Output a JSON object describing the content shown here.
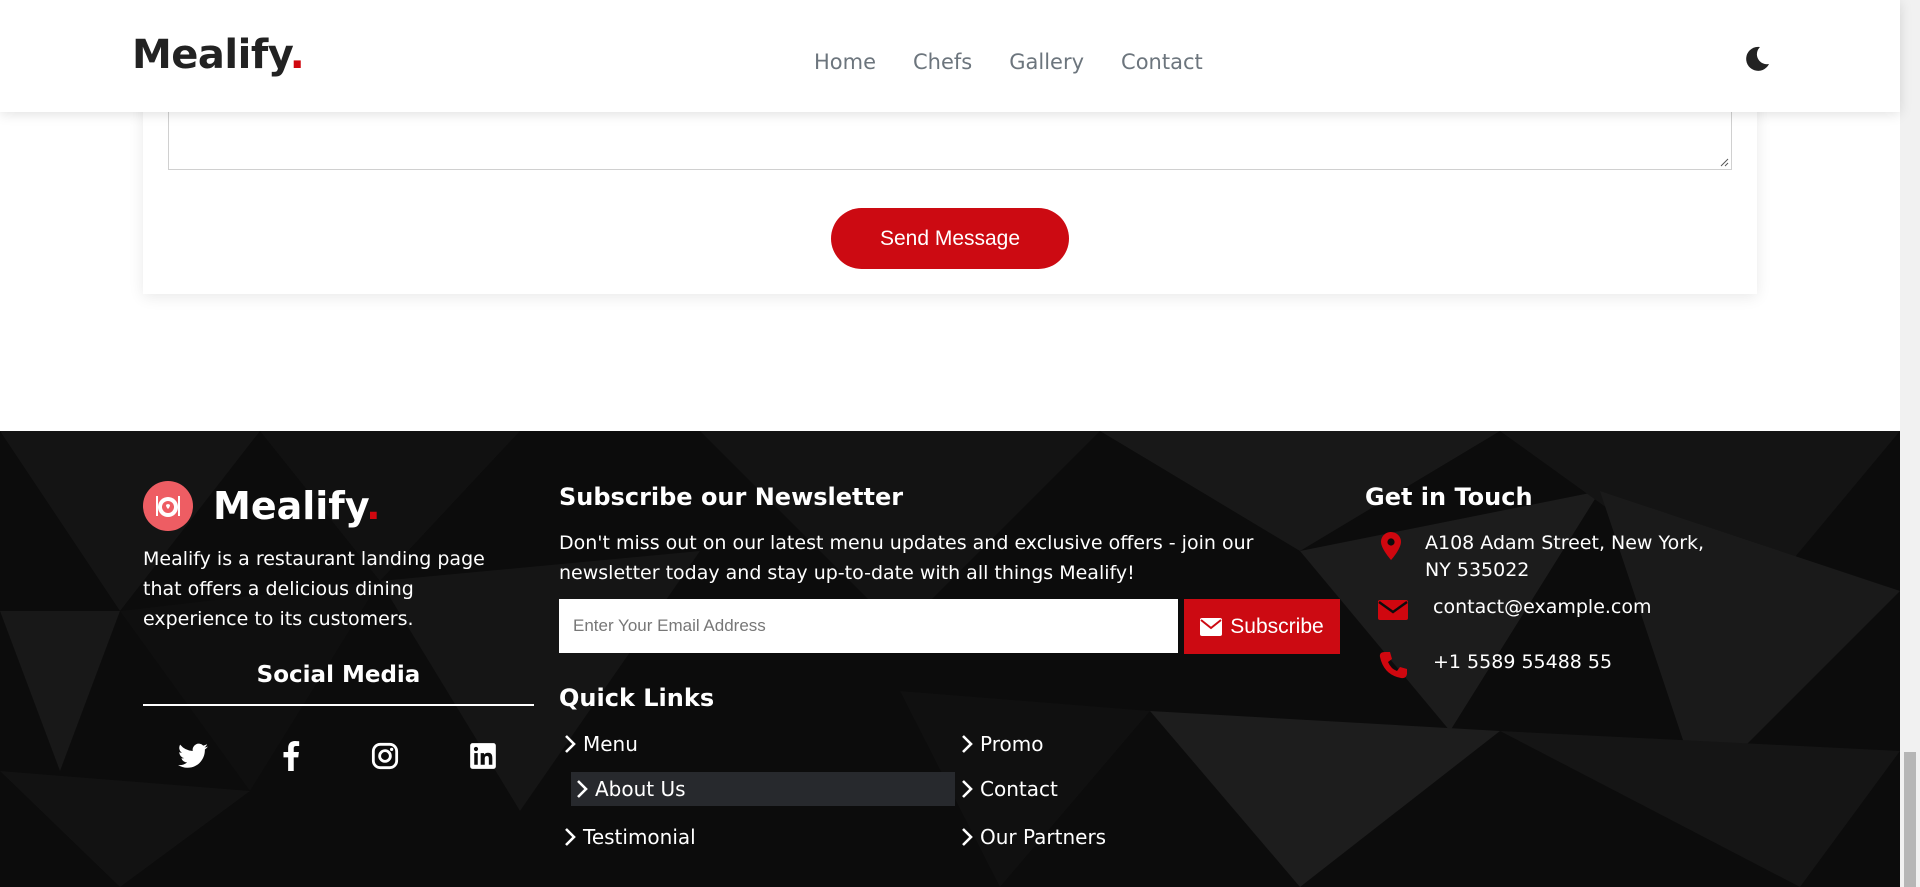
{
  "header": {
    "brand": "Mealify",
    "brand_dot": ".",
    "nav": [
      "Home",
      "Chefs",
      "Gallery",
      "Contact"
    ],
    "theme_icon": "moon-icon"
  },
  "form": {
    "send_label": "Send Message"
  },
  "footer": {
    "brand": "Mealify",
    "brand_dot": ".",
    "about": "Mealify is a restaurant landing page that offers a delicious dining experience to its customers.",
    "social_title": "Social Media",
    "social_icons": [
      "twitter-icon",
      "facebook-icon",
      "instagram-icon",
      "linkedin-icon"
    ],
    "newsletter": {
      "title": "Subscribe our Newsletter",
      "text": "Don't miss out on our latest menu updates and exclusive offers - join our newsletter today and stay up-to-date with all things Mealify!",
      "placeholder": "Enter Your Email Address",
      "subscribe_label": "Subscribe"
    },
    "quick_links": {
      "title": "Quick Links",
      "items": [
        "Menu",
        "Promo",
        "About Us",
        "Contact",
        "Testimonial",
        "Our Partners"
      ]
    },
    "get_in_touch": {
      "title": "Get in Touch",
      "address": "A108 Adam Street, New York, NY 535022",
      "email": "contact@example.com",
      "phone": "+1 5589 55488 55"
    }
  },
  "colors": {
    "accent": "#cc0a12",
    "footer_bg": "#0c0c0c",
    "logo_circle": "#ee5d63"
  }
}
